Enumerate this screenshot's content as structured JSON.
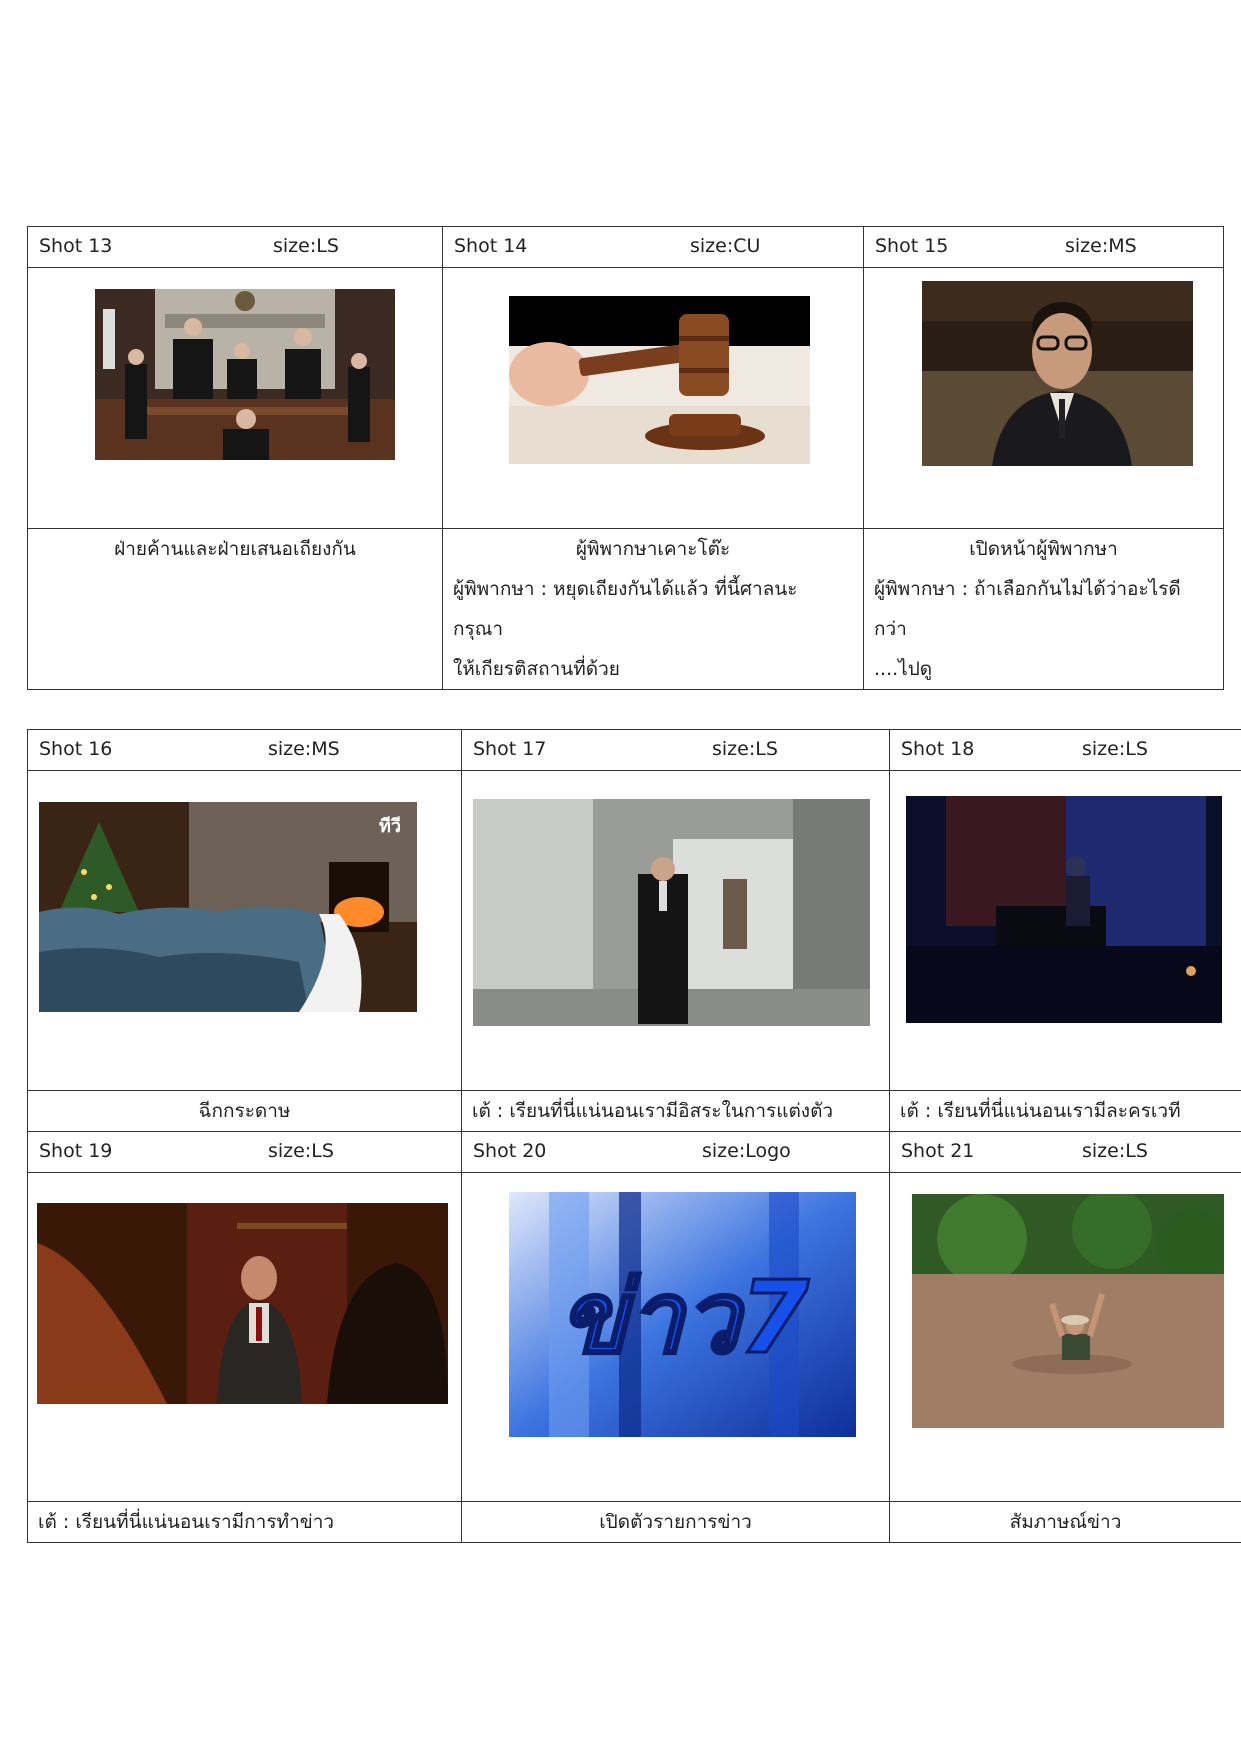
{
  "tables": [
    {
      "shots": [
        {
          "shot": "Shot 13",
          "size": "size:LS",
          "image": "courtroom-photo",
          "caption": [
            "ฝ่ายค้านและฝ่ายเสนอเถียงกัน"
          ]
        },
        {
          "shot": "Shot 14",
          "size": "size:CU",
          "image": "gavel-photo",
          "caption": [
            "ผู้พิพากษาเคาะโต๊ะ",
            "ผู้พิพากษา : หยุดเถียงกันได้แล้ว ที่นี้ศาลนะ กรุณา",
            "ให้เกียรติสถานที่ด้วย"
          ]
        },
        {
          "shot": "Shot 15",
          "size": "size:MS",
          "image": "judge-face-photo",
          "caption": [
            "เปิดหน้าผู้พิพากษา",
            "ผู้พิพากษา : ถ้าเลือกกันไม่ได้ว่าอะไรดีกว่า",
            "....ไปดู"
          ]
        }
      ]
    },
    {
      "shots": [
        {
          "shot": "Shot 16",
          "size": "size:MS",
          "image": "christmas-fireplace-ocean-photo",
          "caption": [
            "ฉีกกระดาษ"
          ]
        },
        {
          "shot": "Shot 17",
          "size": "size:LS",
          "image": "hallway-man-photo",
          "caption": [
            "เต้ : เรียนที่นี่แน่นอนเรามีอิสระในการแต่งตัว"
          ]
        },
        {
          "shot": "Shot 18",
          "size": "size:LS",
          "image": "stage-piano-photo",
          "caption": [
            "เต้ : เรียนที่นี่แน่นอนเรามีละครเวที"
          ]
        },
        {
          "shot": "Shot 19",
          "size": "size:LS",
          "image": "bald-man-photo",
          "caption": [
            "เต้ : เรียนที่นี่แน่นอนเรามีการทำข่าว"
          ]
        },
        {
          "shot": "Shot 20",
          "size": "size:Logo",
          "image": "news-logo",
          "caption": [
            "เปิดตัวรายการข่าว"
          ]
        },
        {
          "shot": "Shot 21",
          "size": "size:LS",
          "image": "flood-man-photo",
          "caption": [
            "สัมภาษณ์ข่าว"
          ]
        }
      ]
    }
  ],
  "colors": {
    "border": "#333333",
    "text": "#222222",
    "news_blue": "#1a4fd6"
  },
  "logo_text": "ข่าว7"
}
